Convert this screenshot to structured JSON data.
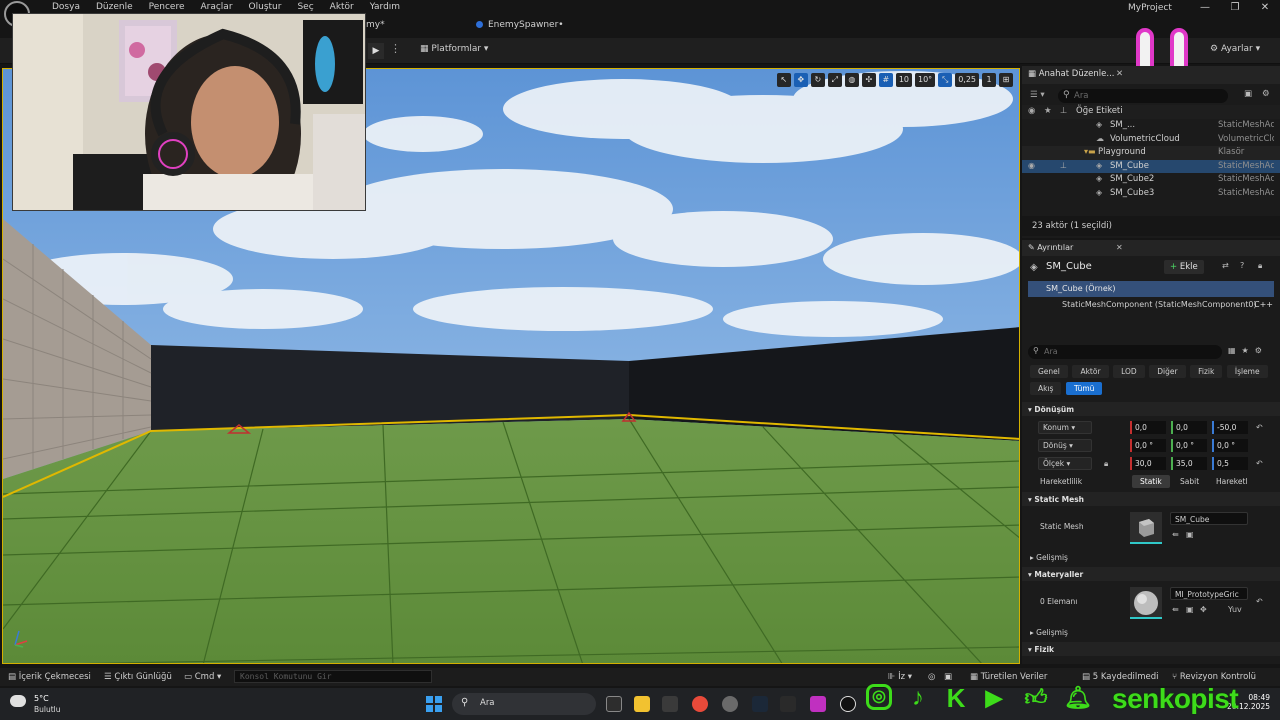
{
  "menu": [
    "Dosya",
    "Düzenle",
    "Pencere",
    "Araçlar",
    "Oluştur",
    "Seç",
    "Aktör",
    "Yardım"
  ],
  "tabs": {
    "level_fragment": "my*",
    "enemy_spawner": "EnemySpawner•"
  },
  "project_name": "MyProject",
  "window_controls": [
    "—",
    "❐",
    "✕"
  ],
  "toolbar": {
    "platforms_label": "Platformlar",
    "settings_label": "Ayarlar"
  },
  "viewport_toolbar": {
    "grid_snap": "10",
    "rotation_snap": "10°",
    "scale_snap": "0,25",
    "camera_speed": "1"
  },
  "outliner": {
    "title": "Anahat Düzenle...",
    "search_placeholder": "Ara",
    "column_label": "Öğe Etiketi",
    "column_type": "Tür",
    "rows": [
      {
        "name": "SM_...",
        "type": "StaticMeshAc",
        "indent": 2,
        "kind": "mesh"
      },
      {
        "name": "VolumetricCloud",
        "type": "VolumetricClo",
        "indent": 2,
        "kind": "cloud"
      },
      {
        "name": "Playground",
        "type": "Klasör",
        "indent": 1,
        "kind": "folder"
      },
      {
        "name": "SM_Cube",
        "type": "StaticMeshAc",
        "indent": 2,
        "kind": "mesh",
        "selected": true
      },
      {
        "name": "SM_Cube2",
        "type": "StaticMeshAc",
        "indent": 2,
        "kind": "mesh"
      },
      {
        "name": "SM_Cube3",
        "type": "StaticMeshAc",
        "indent": 2,
        "kind": "mesh"
      }
    ],
    "count_text": "23 aktör (1 seçildi)"
  },
  "details": {
    "title": "Ayrıntılar",
    "actor_name": "SM_Cube",
    "add_label": "Ekle",
    "component_root": "SM_Cube (Örnek)",
    "component_child": "StaticMeshComponent (StaticMeshComponent0)",
    "component_child_tag": "C++",
    "search_placeholder": "Ara",
    "filters": [
      "Genel",
      "Aktör",
      "LOD",
      "Diğer",
      "Fizik",
      "İşleme",
      "Akış",
      "Tümü"
    ],
    "active_filter": "Tümü",
    "transform": {
      "section": "Dönüşüm",
      "location_label": "Konum",
      "location": [
        "0,0",
        "0,0",
        "-50,0"
      ],
      "rotation_label": "Dönüş",
      "rotation": [
        "0,0 °",
        "0,0 °",
        "0,0 °"
      ],
      "scale_label": "Ölçek",
      "scale": [
        "30,0",
        "35,0",
        "0,5"
      ],
      "mobility_label": "Hareketlilik",
      "mobility_options": [
        "Statik",
        "Sabit",
        "Hareketl"
      ],
      "mobility_selected": "Statik"
    },
    "static_mesh": {
      "section": "Static Mesh",
      "label": "Static Mesh",
      "asset": "SM_Cube",
      "advanced": "Gelişmiş"
    },
    "materials": {
      "section": "Materyaller",
      "label": "0 Elemanı",
      "asset": "MI_PrototypeGric",
      "extra": "Yuv",
      "advanced": "Gelişmiş"
    },
    "physics_section": "Fizik"
  },
  "statusbar": {
    "content_drawer": "İçerik Çekmecesi",
    "output_log": "Çıktı Günlüğü",
    "cmd": "Cmd",
    "cmd_placeholder": "Konsol Komutunu Gir",
    "trace": "İz",
    "derived_data": "Türetilen Veriler",
    "unsaved": "5 Kaydedilmedi",
    "revision": "Revizyon Kontrolü"
  },
  "taskbar": {
    "weather_temp": "5°C",
    "weather_cond": "Bulutlu",
    "search_label": "Ara",
    "time": "08:49",
    "date": "28.12.2025"
  },
  "branding": {
    "channel": "senkopist",
    "socials": [
      "instagram-icon",
      "tiktok-icon",
      "kick-icon",
      "youtube-icon",
      "like-icon",
      "bell-icon"
    ]
  },
  "colors": {
    "accent": "#1a6fd0",
    "brand_green": "#3ddc1a",
    "selection_outline": "#d4b000",
    "overlay_pink": "#e038c8"
  }
}
